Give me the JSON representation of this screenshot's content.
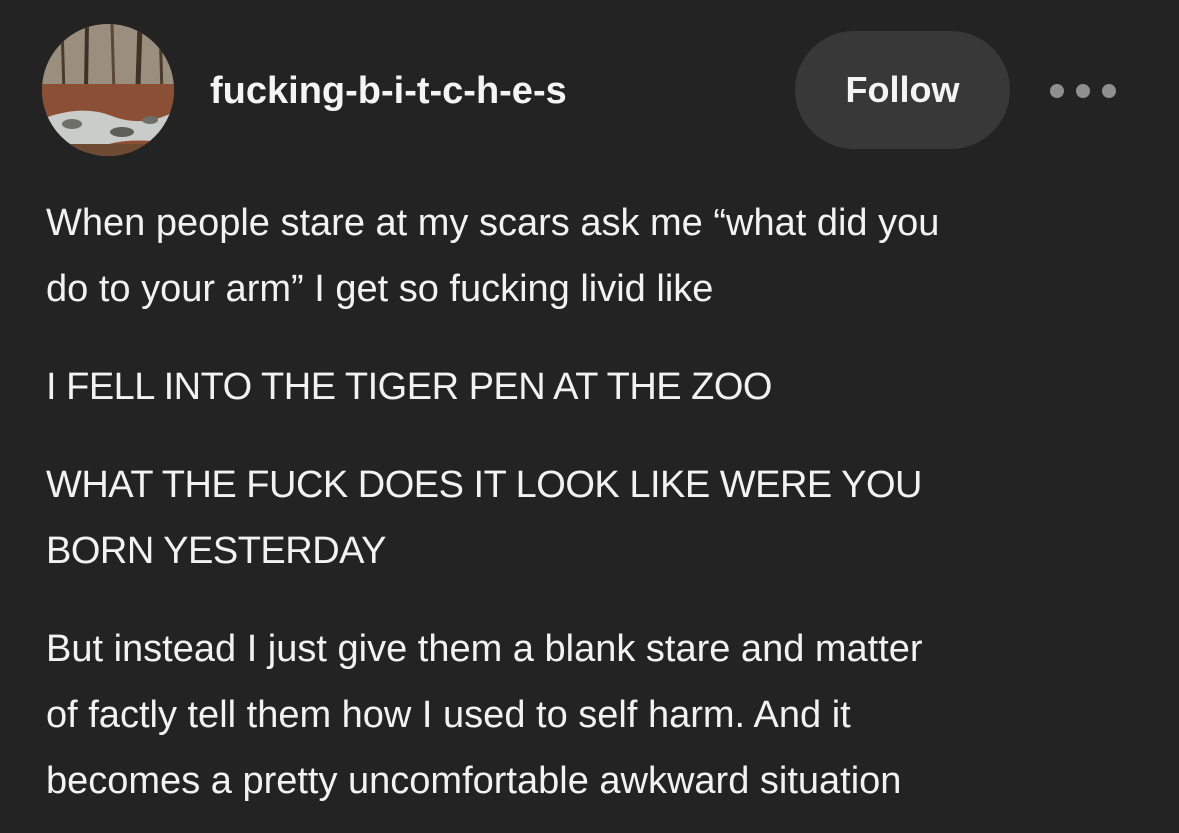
{
  "post": {
    "author": {
      "username": "fucking-b-i-t-c-h-e-s",
      "avatar_icon": "forest-stream-avatar"
    },
    "follow_label": "Follow",
    "more_icon": "ellipsis-icon",
    "paragraphs": [
      "When people stare at my scars ask me “what did you\ndo to your arm” I get so fucking livid like",
      "I FELL INTO THE TIGER PEN AT THE ZOO",
      "WHAT THE FUCK DOES IT LOOK LIKE WERE YOU\nBORN YESTERDAY",
      "But instead I just give them a blank stare and matter\nof factly tell them how I used to self harm. And it\nbecomes a pretty uncomfortable awkward situation"
    ]
  },
  "colors": {
    "background": "#232323",
    "text": "#f2f2f2",
    "button_bg": "#383838",
    "dots": "#8f8f8f"
  }
}
